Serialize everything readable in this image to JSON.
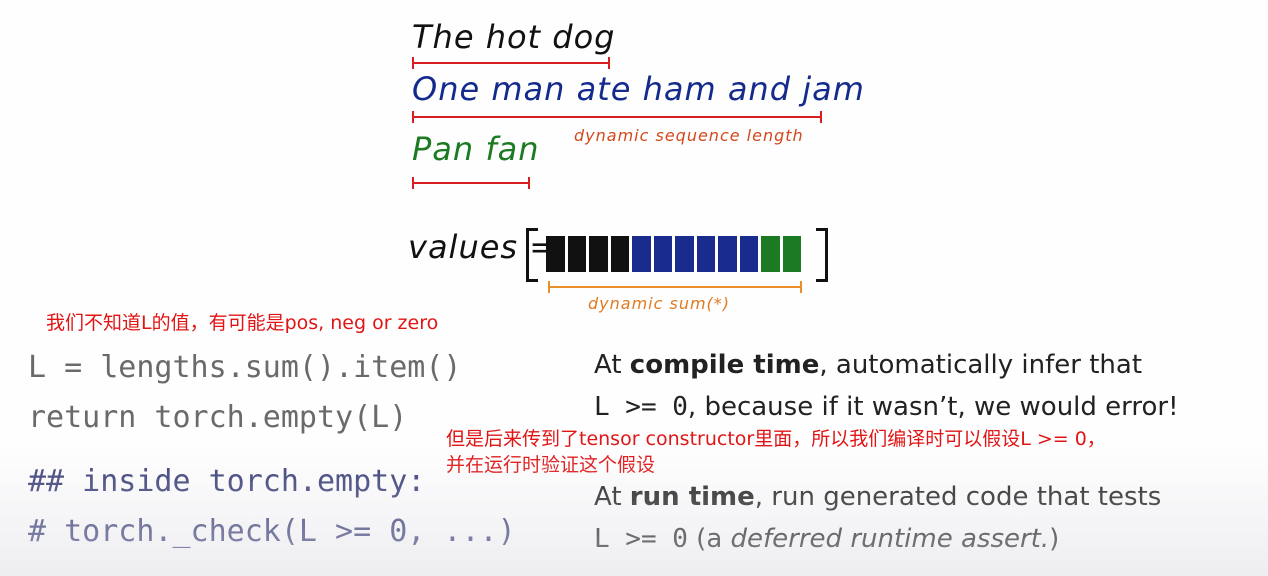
{
  "slide": {
    "sentences": [
      "The hot dog",
      "One man ate ham and jam",
      "Pan fan"
    ],
    "annotation_dynamic_length": "dynamic sequence length",
    "values_label": "values =",
    "value_cells": [
      "#111111",
      "#111111",
      "#111111",
      "#111111",
      "#1a2b8e",
      "#1a2b8e",
      "#1a2b8e",
      "#1a2b8e",
      "#1a2b8e",
      "#1a2b8e",
      "#1c7a22",
      "#1c7a22"
    ],
    "annotation_dynamic_sum": "dynamic sum(*)",
    "note_cn_1": "我们不知道L的值，有可能是pos, neg or zero",
    "code": {
      "line1": "L = lengths.sum().item()",
      "line2": "return torch.empty(L)",
      "line3": "## inside torch.empty:",
      "line4": "# torch._check(L >= 0, ...)"
    },
    "compile": {
      "prefix": "At ",
      "bold": "compile time",
      "suffix": ", automatically infer that",
      "line2_code": "L >= 0",
      "line2_rest": ", because if it wasn’t, we would error!"
    },
    "note_cn_2_line1": "但是后来传到了tensor constructor里面，所以我们编译时可以假设L >= 0，",
    "note_cn_2_line2": "并在运行时验证这个假设",
    "runtime": {
      "prefix": "At ",
      "bold": "run time",
      "suffix": ", run generated code that tests",
      "line2_code": "L >= 0",
      "line2_open": " (a ",
      "line2_italic": "deferred runtime assert.",
      "line2_close": ")"
    },
    "colors": {
      "underline_red": "#d81e1e",
      "note_red": "#e11515",
      "annotation_orange": "#e07a20"
    }
  }
}
